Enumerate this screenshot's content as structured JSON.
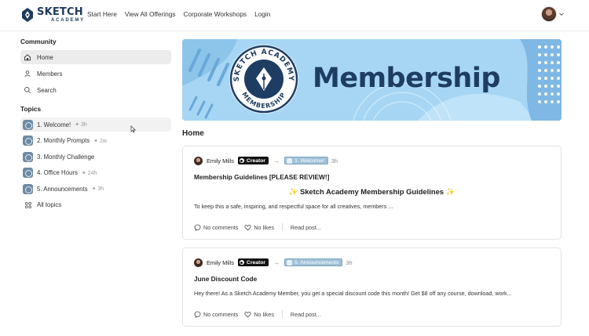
{
  "brand": {
    "name_line1": "SKETCH",
    "name_line2": "ACADEMY"
  },
  "nav": {
    "links": [
      "Start Here",
      "View All Offerings",
      "Corporate Workshops",
      "Login"
    ]
  },
  "sidebar": {
    "community_title": "Community",
    "community_items": [
      {
        "label": "Home",
        "icon": "home-icon",
        "active": true
      },
      {
        "label": "Members",
        "icon": "user-icon",
        "active": false
      },
      {
        "label": "Search",
        "icon": "search-icon",
        "active": false
      }
    ],
    "topics_title": "Topics",
    "topics": [
      {
        "label": "1. Welcome!",
        "time": "3h"
      },
      {
        "label": "2. Monthly Prompts",
        "time": "2w"
      },
      {
        "label": "3. Monthly Challenge",
        "time": ""
      },
      {
        "label": "4. Office Hours",
        "time": "24h"
      },
      {
        "label": "5. Announcements",
        "time": "3h"
      }
    ],
    "all_topics": "All topics"
  },
  "banner": {
    "title": "Membership",
    "seal_top": "SKETCH ACADEMY",
    "seal_bottom": "MEMBERSHIP"
  },
  "main": {
    "heading": "Home"
  },
  "posts": [
    {
      "author": "Emily Mills",
      "badge": "Creator",
      "topic": "1. Welcome!",
      "time": "3h",
      "title": "Membership Guidelines [PLEASE REVIEW!]",
      "subtitle": "✨ Sketch Academy Membership Guidelines ✨",
      "excerpt": "To keep this a safe, inspiring, and respectful space for all creatives, members ...",
      "comments": "No comments",
      "likes": "No likes",
      "read": "Read post..."
    },
    {
      "author": "Emily Mills",
      "badge": "Creator",
      "topic": "5. Announcements",
      "time": "3h",
      "title": "June Discount Code",
      "excerpt": "Hey there! As a Sketch Academy Member, you get a special discount code this month! Get $8 off any course, download, work...",
      "comments": "No comments",
      "likes": "No likes",
      "read": "Read post..."
    }
  ],
  "colors": {
    "brand_navy": "#1f3a5c",
    "banner_blue": "#9fd2f2",
    "topic_tag": "#9fc1d8"
  }
}
